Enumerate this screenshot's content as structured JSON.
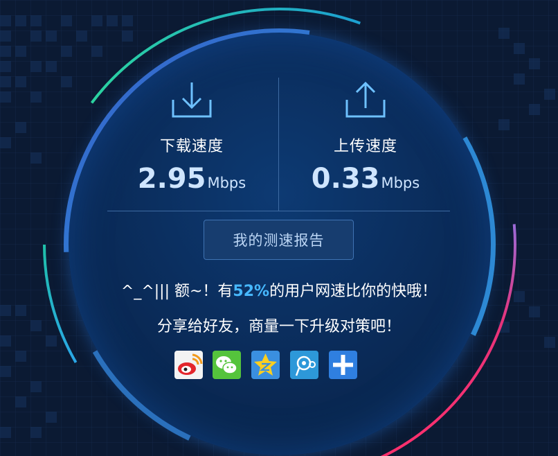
{
  "download": {
    "label": "下载速度",
    "value": "2.95",
    "unit": "Mbps",
    "icon": "download-icon"
  },
  "upload": {
    "label": "上传速度",
    "value": "0.33",
    "unit": "Mbps",
    "icon": "upload-icon"
  },
  "report_button": {
    "label": "我的测速报告"
  },
  "message": {
    "line1_prefix": "^_^||| 额~！有",
    "line1_percent": "52%",
    "line1_suffix": "的用户网速比你的快哦！",
    "line2": "分享给好友，商量一下升级对策吧！"
  },
  "share_icons": [
    "weibo-icon",
    "wechat-icon",
    "qzone-icon",
    "tencent-weibo-icon",
    "more-share-icon"
  ],
  "colors": {
    "accent": "#47b8ff",
    "background": "#0b1a33",
    "ring_blue": "#3a82c6",
    "ring_teal": "#1fc0a8",
    "ring_pink": "#e7337a"
  }
}
